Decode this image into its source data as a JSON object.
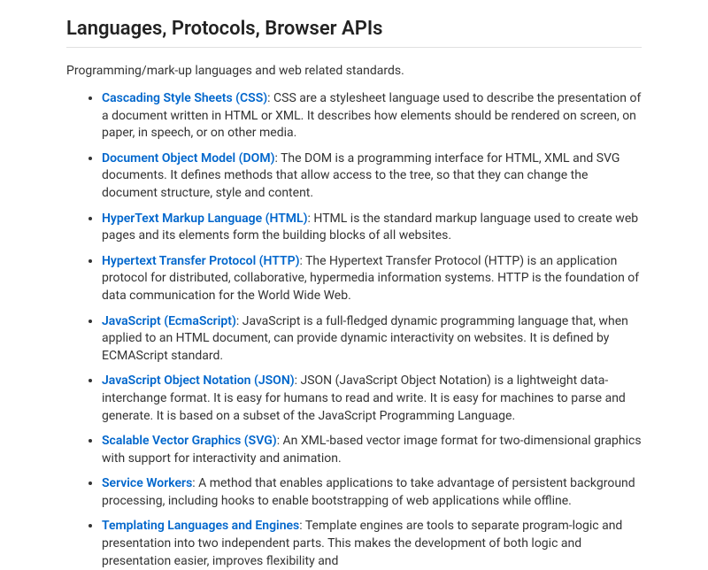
{
  "heading": "Languages, Protocols, Browser APIs",
  "intro": "Programming/mark-up languages and web related standards.",
  "items": [
    {
      "label": "Cascading Style Sheets (CSS)",
      "desc": ": CSS are a stylesheet language used to describe the presentation of a document written in HTML or XML. It describes how elements should be rendered on screen, on paper, in speech, or on other media."
    },
    {
      "label": "Document Object Model (DOM)",
      "desc": ": The DOM is a programming interface for HTML, XML and SVG documents. It defines methods that allow access to the tree, so that they can change the document structure, style and content."
    },
    {
      "label": "HyperText Markup Language (HTML)",
      "desc": ": HTML is the standard markup language used to create web pages and its elements form the building blocks of all websites."
    },
    {
      "label": "Hypertext Transfer Protocol (HTTP)",
      "desc": ": The Hypertext Transfer Protocol (HTTP) is an application protocol for distributed, collaborative, hypermedia information systems. HTTP is the foundation of data communication for the World Wide Web."
    },
    {
      "label": "JavaScript (EcmaScript)",
      "desc": ": JavaScript is a full-fledged dynamic programming language that, when applied to an HTML document, can provide dynamic interactivity on websites. It is defined by ECMAScript standard."
    },
    {
      "label": "JavaScript Object Notation (JSON)",
      "desc": ": JSON (JavaScript Object Notation) is a lightweight data-interchange format. It is easy for humans to read and write. It is easy for machines to parse and generate. It is based on a subset of the JavaScript Programming Language."
    },
    {
      "label": "Scalable Vector Graphics (SVG)",
      "desc": ": An XML-based vector image format for two-dimensional graphics with support for interactivity and animation."
    },
    {
      "label": "Service Workers",
      "desc": ": A method that enables applications to take advantage of persistent background processing, including hooks to enable bootstrapping of web applications while offline."
    },
    {
      "label": "Templating Languages and Engines",
      "desc": ": Template engines are tools to separate program-logic and presentation into two independent parts. This makes the development of both logic and presentation easier, improves flexibility and"
    }
  ]
}
